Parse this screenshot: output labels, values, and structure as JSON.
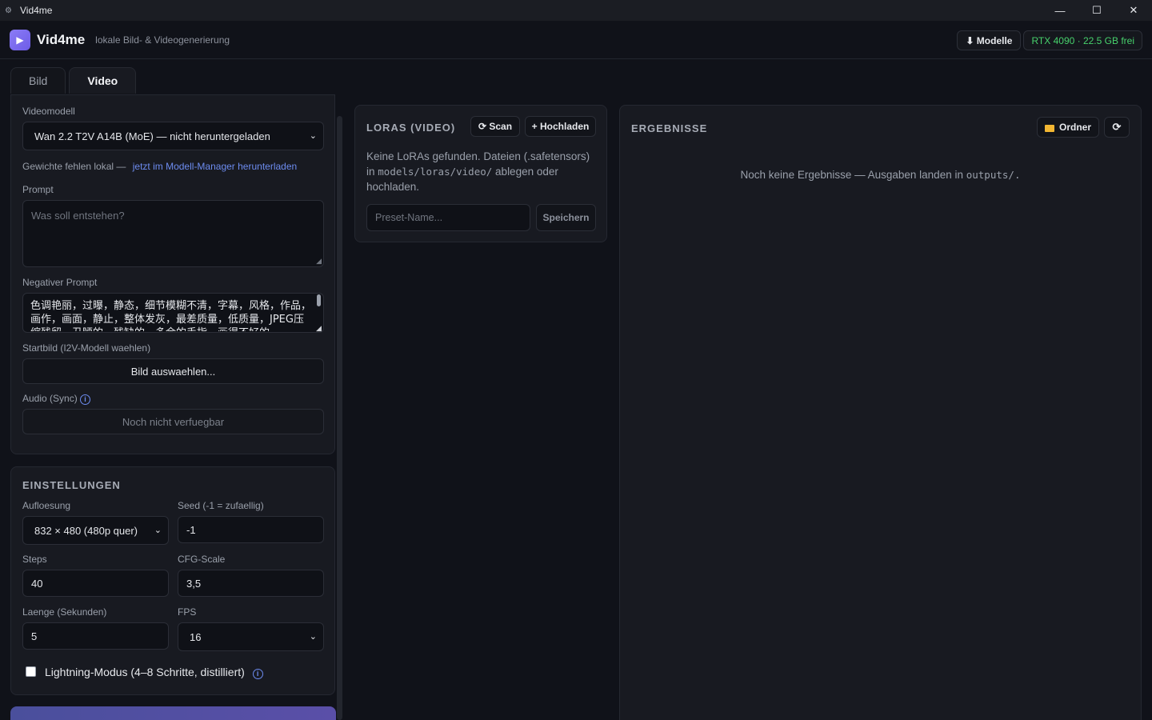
{
  "window": {
    "title": "Vid4me",
    "controls": {
      "minimize": "—",
      "maximize": "☐",
      "close": "✕"
    }
  },
  "header": {
    "brand": "Vid4me",
    "tagline": "lokale Bild- & Videogenerierung",
    "models_button": "⬇ Modelle",
    "gpu_status": "RTX 4090 · 22.5 GB frei"
  },
  "tabs": [
    {
      "label": "Bild",
      "active": false
    },
    {
      "label": "Video",
      "active": true
    }
  ],
  "video_form": {
    "model_label": "Videomodell",
    "model_value": "Wan 2.2 T2V A14B (MoE) — nicht heruntergeladen",
    "weights_missing_text": "Gewichte fehlen lokal —",
    "weights_missing_link": "jetzt im Modell-Manager herunterladen",
    "prompt_label": "Prompt",
    "prompt_placeholder": "Was soll entstehen?",
    "negative_label": "Negativer Prompt",
    "negative_value": "色调艳丽，过曝，静态，细节模糊不清，字幕，风格，作品，画作，画面，静止，整体发灰，最差质量，低质量，JPEG压缩残留，丑陋的，残缺的，多余的手指，画得不好的",
    "start_image_label": "Startbild (I2V-Modell waehlen)",
    "start_image_button": "Bild auswaehlen...",
    "audio_label": "Audio (Sync)",
    "audio_value": "Noch nicht verfuegbar"
  },
  "settings": {
    "title": "EINSTELLUNGEN",
    "resolution_label": "Aufloesung",
    "resolution_value": "832 × 480 (480p quer)",
    "seed_label": "Seed (-1 = zufaellig)",
    "seed_value": "-1",
    "steps_label": "Steps",
    "steps_value": "40",
    "cfg_label": "CFG-Scale",
    "cfg_value": "3,5",
    "length_label": "Laenge (Sekunden)",
    "length_value": "5",
    "fps_label": "FPS",
    "fps_value": "16",
    "lightning_label": "Lightning-Modus (4–8 Schritte, distilliert)",
    "lightning_checked": false
  },
  "loras": {
    "title": "LORAS (VIDEO)",
    "scan_button": "⟳ Scan",
    "upload_button": "+ Hochladen",
    "empty_line1": "Keine LoRAs gefunden. Dateien (.safetensors)",
    "empty_in": "in",
    "empty_path": "models/loras/video/",
    "empty_rest": "ablegen oder",
    "empty_line3": "hochladen.",
    "preset_placeholder": "Preset-Name...",
    "save_button": "Speichern"
  },
  "results": {
    "title": "ERGEBNISSE",
    "folder_button": "Ordner",
    "refresh_button": "⟳",
    "empty_text": "Noch keine Ergebnisse — Ausgaben landen in",
    "empty_path": "outputs/."
  },
  "colors": {
    "accent": "#6d5ce7",
    "link": "#6d8cf0",
    "gpu_ok": "#47d16c",
    "background": "#101219",
    "panel": "#181a21"
  }
}
